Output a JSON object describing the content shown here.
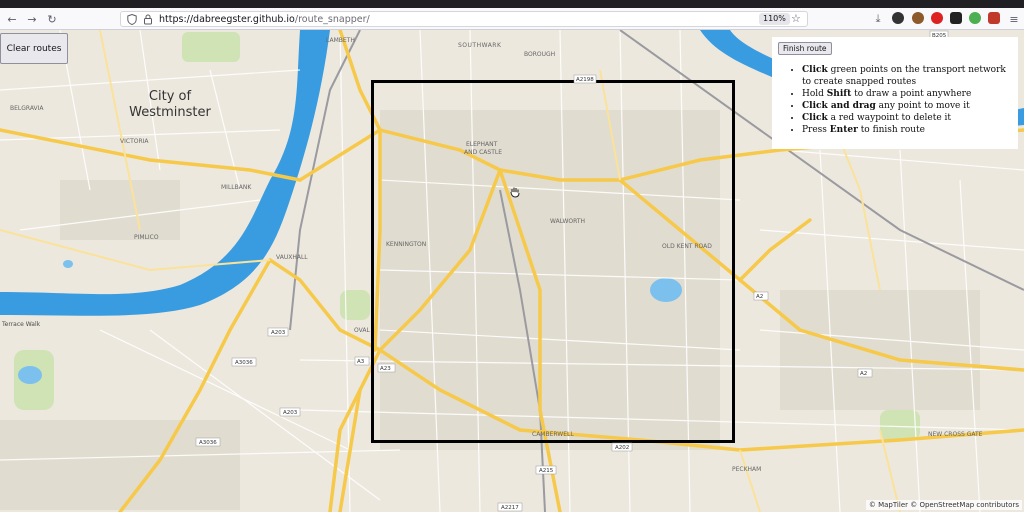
{
  "browser": {
    "url_host": "https://dabreegster.github.io",
    "url_path": "/route_snapper/",
    "zoom": "110%"
  },
  "map": {
    "clear_routes_label": "Clear routes",
    "finish_route_label": "Finish route",
    "instructions": [
      {
        "bold": "Click",
        "text": " green points on the transport network to create snapped routes"
      },
      {
        "pre": "Hold ",
        "bold": "Shift",
        "text": " to draw a point anywhere"
      },
      {
        "bold": "Click and drag",
        "text": " any point to move it"
      },
      {
        "bold": "Click",
        "text": " a red waypoint to delete it"
      },
      {
        "pre": "Press ",
        "bold": "Enter",
        "text": " to finish route"
      }
    ],
    "attribution": "© MapTiler © OpenStreetMap contributors",
    "labels": {
      "westminster_1": "City of",
      "westminster_2": "Westminster",
      "southwark": "SOUTHWARK",
      "borough": "BOROUGH",
      "lambeth": "LAMBETH",
      "belgravia": "BELGRAVIA",
      "victoria": "VICTORIA",
      "millbank": "MILLBANK",
      "pimlico": "PIMLICO",
      "vauxhall": "VAUXHALL",
      "kennington": "KENNINGTON",
      "oval": "OVAL",
      "elephant_1": "ELEPHANT",
      "elephant_2": "AND CASTLE",
      "walworth": "WALWORTH",
      "old_kent_road": "OLD KENT ROAD",
      "camberwell": "CAMBERWELL",
      "peckham": "PECKHAM",
      "new_cross_gate": "NEW CROSS GATE",
      "terrace_walk": "Terrace Walk",
      "a203": "A203",
      "a3036": "A3036",
      "a3": "A3",
      "a23": "A23",
      "a202": "A202",
      "a215": "A215",
      "a2217": "A2217",
      "a2": "A2",
      "a2198": "A2198",
      "b205": "B205",
      "a2_b": "A2"
    }
  },
  "colors": {
    "river": "#3a9ce0",
    "major_road": "#f6c94a",
    "box": "#000000"
  }
}
